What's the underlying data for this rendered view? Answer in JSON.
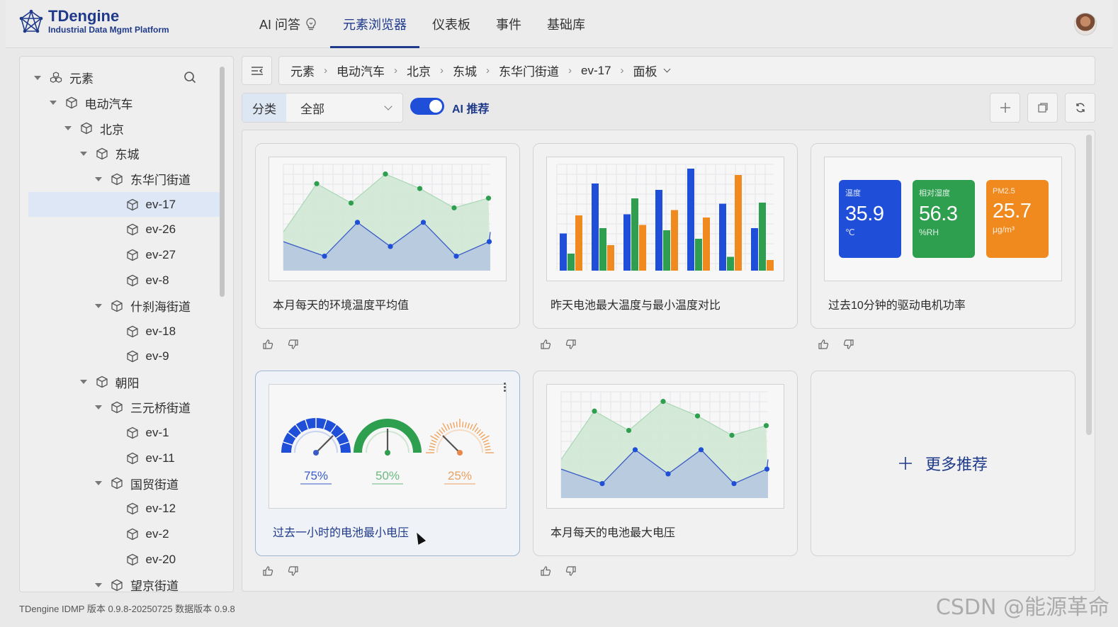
{
  "app": {
    "name": "TDengine",
    "tagline": "Industrial Data Mgmt Platform"
  },
  "nav": {
    "items": [
      {
        "label": "AI 问答"
      },
      {
        "label": "元素浏览器"
      },
      {
        "label": "仪表板"
      },
      {
        "label": "事件"
      },
      {
        "label": "基础库"
      }
    ],
    "active": "元素浏览器"
  },
  "tree": {
    "root": "元素",
    "items": [
      {
        "label": "电动汽车"
      },
      {
        "label": "北京"
      },
      {
        "label": "东城"
      },
      {
        "label": "东华门街道"
      },
      {
        "label": "ev-17"
      },
      {
        "label": "ev-26"
      },
      {
        "label": "ev-27"
      },
      {
        "label": "ev-8"
      },
      {
        "label": "什刹海街道"
      },
      {
        "label": "ev-18"
      },
      {
        "label": "ev-9"
      },
      {
        "label": "朝阳"
      },
      {
        "label": "三元桥街道"
      },
      {
        "label": "ev-1"
      },
      {
        "label": "ev-11"
      },
      {
        "label": "国贸街道"
      },
      {
        "label": "ev-12"
      },
      {
        "label": "ev-2"
      },
      {
        "label": "ev-20"
      },
      {
        "label": "望京街道"
      }
    ],
    "selected": "ev-17"
  },
  "breadcrumb": [
    "元素",
    "电动汽车",
    "北京",
    "东城",
    "东华门街道",
    "ev-17",
    "面板"
  ],
  "filter": {
    "label": "分类",
    "value": "全部"
  },
  "ai_toggle": {
    "label": "AI 推荐",
    "on": true
  },
  "cards": [
    {
      "title": "本月每天的环境温度平均值",
      "type": "area"
    },
    {
      "title": "昨天电池最大温度与最小温度对比",
      "type": "bar"
    },
    {
      "title": "过去10分钟的驱动电机功率",
      "type": "stat"
    },
    {
      "title": "过去一小时的电池最小电压",
      "type": "gauge"
    },
    {
      "title": "本月每天的电池最大电压",
      "type": "area"
    }
  ],
  "more": {
    "label": "更多推荐"
  },
  "stat_tiles": [
    {
      "label": "温度",
      "value": "35.9",
      "unit": "℃",
      "color": "#1f4fd8"
    },
    {
      "label": "相对湿度",
      "value": "56.3",
      "unit": "%RH",
      "color": "#2e9e4f"
    },
    {
      "label": "PM2.5",
      "value": "25.7",
      "unit": "μg/m³",
      "color": "#f08a1f"
    }
  ],
  "gauges": [
    {
      "label": "75%",
      "value": 0.75,
      "color": "#1f4fd8"
    },
    {
      "label": "50%",
      "value": 0.5,
      "color": "#2e9e4f"
    },
    {
      "label": "25%",
      "value": 0.25,
      "color": "#f0a35a"
    }
  ],
  "area_chart": {
    "series_a": [
      4,
      9,
      7,
      10,
      8.5,
      6.5,
      7.5
    ],
    "series_b": [
      1.5,
      5,
      2.5,
      5,
      1.5,
      3
    ]
  },
  "bar_chart": {
    "series": [
      {
        "color": "#1f4fd8",
        "values": [
          3.5,
          8.2,
          5.3,
          7.6,
          9.6,
          6.3,
          4.0
        ]
      },
      {
        "color": "#2e9e4f",
        "values": [
          1.6,
          4.0,
          6.8,
          3.8,
          3.0,
          1.3,
          6.4
        ]
      },
      {
        "color": "#f08a1f",
        "values": [
          5.2,
          2.4,
          4.3,
          5.7,
          5.0,
          9.0,
          1.0
        ]
      }
    ]
  },
  "footer": "TDengine IDMP 版本 0.9.8-20250725 数据版本 0.9.8",
  "watermark": "CSDN @能源革命"
}
